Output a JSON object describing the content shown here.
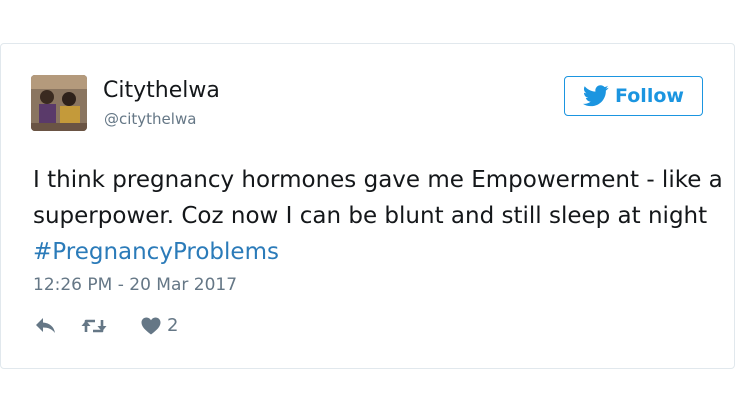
{
  "author": {
    "display_name": "Citythelwa",
    "handle": "@citythelwa"
  },
  "follow_button": {
    "label": "Follow"
  },
  "tweet": {
    "text_before": "I think pregnancy hormones gave me Empowerment - like a superpower. Coz now I can be blunt and still sleep at night ",
    "hashtag": "#PregnancyProblems",
    "timestamp": "12:26 PM - 20 Mar 2017"
  },
  "actions": {
    "reply_icon": "reply-icon",
    "retweet_icon": "retweet-icon",
    "like_icon": "heart-icon",
    "like_count": "2"
  },
  "colors": {
    "twitter_blue": "#1b95e0",
    "hashtag": "#2b7bb9",
    "muted": "#657786",
    "text": "#14171a"
  }
}
